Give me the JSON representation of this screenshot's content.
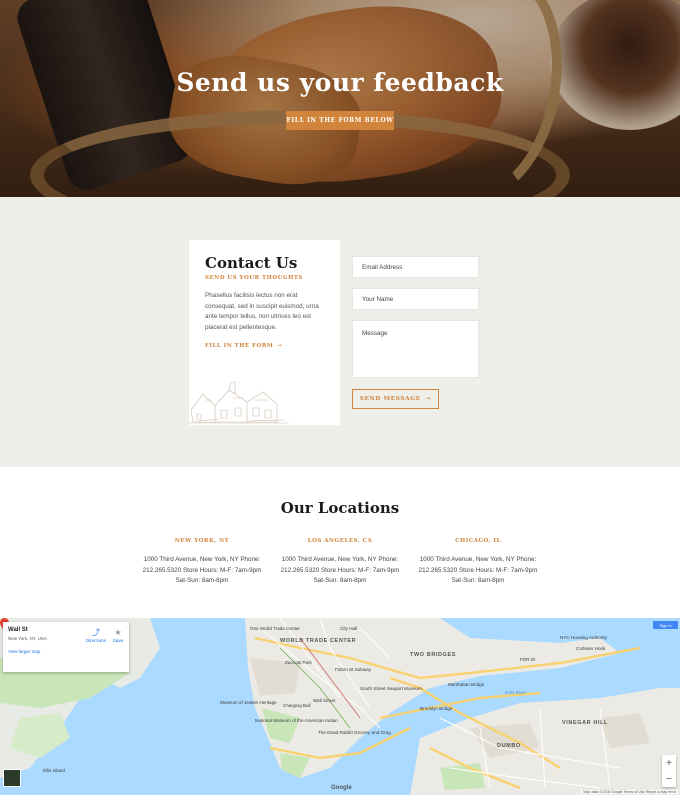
{
  "hero": {
    "title": "Send us your feedback",
    "cta_label": "FILL IN THE FORM BELOW"
  },
  "contact": {
    "title": "Contact Us",
    "subtitle": "SEND US YOUR THOUGHTS",
    "body": "Phasellus facilisis lectus non erat consequat, sed in suscipit euismod, urna ante tempor tellus, non ultrices leo est placerat est pellentesque.",
    "link_label": "FILL IN THE FORM",
    "link_icon": "arrow-right-icon",
    "form": {
      "email_placeholder": "Email Address",
      "name_placeholder": "Your Name",
      "message_placeholder": "Message",
      "send_label": "SEND MESSAGE",
      "send_icon": "arrow-right-icon"
    }
  },
  "locations": {
    "title": "Our Locations",
    "items": [
      {
        "city": "NEW YORK, NY",
        "address": "1000 Third Avenue, New York, NY Phone: 212.265.5320 Store Hours: M-F: 7am-9pm Sat-Sun: 8am-8pm"
      },
      {
        "city": "LOS ANGELES, CA",
        "address": "1000 Third Avenue, New York, NY Phone: 212.265.5320 Store Hours: M-F: 7am-9pm Sat-Sun: 8am-8pm"
      },
      {
        "city": "CHICAGO, IL",
        "address": "1000 Third Avenue, New York, NY Phone: 212.265.5320 Store Hours: M-F: 7am-9pm Sat-Sun: 8am-8pm"
      }
    ]
  },
  "map": {
    "place_title": "Wall St",
    "place_subtitle": "New York, NY, USA",
    "view_larger": "View larger map",
    "directions_label": "Directions",
    "save_label": "Save",
    "sign_in": "Sign in",
    "zoom_in": "+",
    "zoom_out": "−",
    "attribution": "Map data ©2018 Google   Terms of Use   Report a map error",
    "google": "Google",
    "labels": {
      "world_trade": "WORLD TRADE CENTER",
      "two_bridges": "TWO BRIDGES",
      "dumbo": "DUMBO",
      "vinegar_hill": "VINEGAR HILL",
      "east_river": "East River",
      "fdr": "FDR Dr",
      "wall_st": "Wall Street",
      "south_st": "South Street Seaport Museum",
      "brooklyn_bridge": "Brooklyn Bridge",
      "manhattan_bridge": "Manhattan Bridge",
      "ellis": "Ellis Island",
      "nyc_housing": "NYC Housing Authority",
      "corlears": "Corlears Hook",
      "zuccotti": "Zuccotti Park",
      "museum_jewish": "Museum of Jewish Heritage",
      "national_museum": "National Museum of the American Indian",
      "charging_bull": "Charging Bull",
      "dead_rabbit": "The Dead Rabbit Grocery and Grog",
      "fulton": "Fulton St Subway",
      "city_hall": "City Hall",
      "one_wtc": "One World Trade Center"
    }
  }
}
